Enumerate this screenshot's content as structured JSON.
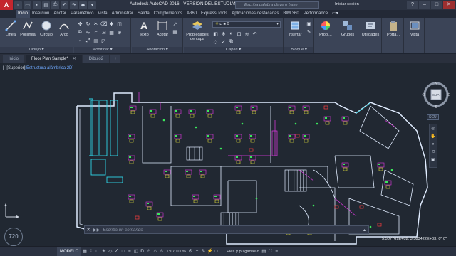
{
  "titlebar": {
    "logo": "A",
    "title": "Autodesk AutoCAD 2016 - VERSIÓN DEL ESTUDIANTE    Floor Plan Sample.dwg",
    "search_placeholder": "Escriba palabra clave o frase",
    "signin": "Iniciar sesión",
    "help": "?",
    "minimize": "–",
    "maximize": "□",
    "close": "✕"
  },
  "ribbon_tabs": [
    "Inicio",
    "Inserción",
    "Anotar",
    "Paramétrico",
    "Vista",
    "Administrar",
    "Salida",
    "Complementos",
    "A360",
    "Express Tools",
    "Aplicaciones destacadas",
    "BIM 360",
    "Performance"
  ],
  "ribbon": {
    "draw": {
      "label": "Dibujo",
      "line": "Línea",
      "polyline": "Polilínea",
      "circle": "Círculo",
      "arc": "Arco"
    },
    "modify": {
      "label": "Modificar"
    },
    "annotation": {
      "label": "Anotación",
      "text": "Texto",
      "dimension": "Acotar"
    },
    "layers": {
      "label": "Capas",
      "props": "Propiedades de capa",
      "current_layer": "0"
    },
    "block": {
      "label": "Bloque",
      "insert": "Insertar"
    },
    "properties": {
      "label": "Propi..."
    },
    "groups": {
      "label": "Grupos"
    },
    "utilities": {
      "label": "Utilidades"
    },
    "clipboard": {
      "label": "Porta..."
    },
    "view": {
      "label": "Vista"
    }
  },
  "doc_tabs": [
    {
      "label": "Inicio",
      "active": false
    },
    {
      "label": "Floor Plan Sample*",
      "active": true
    },
    {
      "label": "Dibujo2",
      "active": false
    }
  ],
  "viewport": {
    "label_prefix": "[-][Superior]",
    "label_style": "[Estructura alámbrica 2D]",
    "wcs": "SCU"
  },
  "viewcube": {
    "n": "N",
    "s": "S",
    "e": "E",
    "w": "O",
    "center": "SUP."
  },
  "command": {
    "prompt": "▶▶",
    "placeholder": "Escriba un comando"
  },
  "watermark": "720",
  "coords": "5.507761E+02, 3.583422E+03, 0\" 0\"",
  "statusbar": {
    "model_tab": "MODELO",
    "scale": "1:1 / 100%",
    "units": "Pies y pulgadas d",
    "plus": "+"
  },
  "colors": {
    "accent": "#c4262e",
    "canvas": "#212832",
    "walls": "#e0ecff",
    "cyan": "#2fd6e8",
    "magenta": "#e63ae8",
    "yellow": "#e8e43a",
    "green": "#3ae85c",
    "red": "#ff3d3d"
  }
}
